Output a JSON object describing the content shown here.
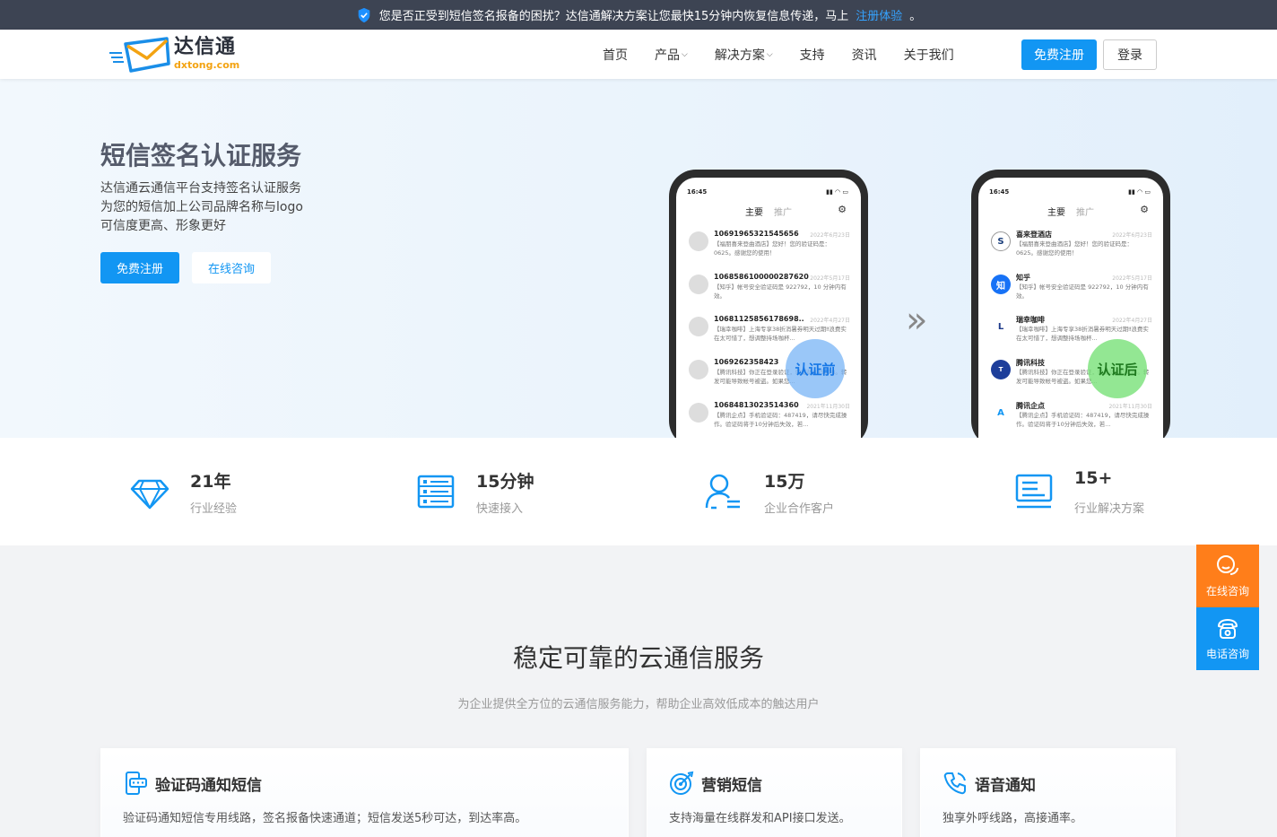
{
  "topbar": {
    "message": "您是否正受到短信签名报备的困扰？达信通解决方案让您最快15分钟内恢复信息传递，马上",
    "link": "注册体验",
    "end": "。"
  },
  "logo": {
    "cn": "达信通",
    "en": "dxtong.com"
  },
  "nav": {
    "items": [
      {
        "label": "首页"
      },
      {
        "label": "产品"
      },
      {
        "label": "解决方案"
      },
      {
        "label": "支持"
      },
      {
        "label": "资讯"
      },
      {
        "label": "关于我们"
      }
    ],
    "register": "免费注册",
    "login": "登录"
  },
  "hero": {
    "title": "短信签名认证服务",
    "desc": [
      "达信通云通信平台支持签名认证服务",
      "为您的短信加上公司品牌名称与logo",
      "可信度更高、形象更好"
    ],
    "btn_register": "免费注册",
    "btn_consult": "在线咨询"
  },
  "phones": {
    "time": "16:45",
    "tab_main": "主要",
    "tab_promo": "推广",
    "before_label": "认证前",
    "after_label": "认证后",
    "before": [
      {
        "name": "10691965321545656",
        "date": "2022年6月23日",
        "body": "【福朋喜来登曲酒店】您好！您的验证码是：0625。感谢您的使用！"
      },
      {
        "name": "1068586100000287620",
        "date": "2022年5月17日",
        "body": "【知乎】帐号安全验证码是 922792，10 分钟内有效。"
      },
      {
        "name": "10681125856178698..",
        "date": "2022年4月27日",
        "body": "【瑞幸咖啡】上海专享38折消暑券明天过期‼浪费实在太可惜了，想调整持场咖杯..."
      },
      {
        "name": "1069262358423",
        "date": "",
        "body": "【腾讯科技】你正在登录验证，验证码845898。转发可能导致帐号被盗。如果您..."
      },
      {
        "name": "10684813023514360",
        "date": "2021年11月30日",
        "body": "【腾讯企点】手机验证码：487419，请尽快完成操作。验证码将于10分钟后失效，若..."
      }
    ],
    "after": [
      {
        "name": "喜来登酒店",
        "date": "2022年6月23日",
        "body": "【福朋喜来登曲酒店】您好！您的验证码是：0625。感谢您的使用！",
        "avatar": "S"
      },
      {
        "name": "知乎",
        "date": "2022年5月17日",
        "body": "【知乎】帐号安全验证码是 922792，10 分钟内有效。",
        "avatar": "知"
      },
      {
        "name": "瑞幸咖啡",
        "date": "2022年4月27日",
        "body": "【瑞幸咖啡】上海专享38折消暑券明天过期‼浪费实在太可惜了，想调整持场咖杯...",
        "avatar": "L"
      },
      {
        "name": "腾讯科技",
        "date": "",
        "body": "【腾讯科技】你正在登录验证，验证码845898。转发可能导致帐号被盗。如果您...",
        "avatar": "T"
      },
      {
        "name": "腾讯企点",
        "date": "2021年11月30日",
        "body": "【腾讯企点】手机验证码：487419，请尽快完成操作。验证码将于10分钟后失效，若...",
        "avatar": "A"
      }
    ]
  },
  "stats": [
    {
      "num": "21年",
      "label": "行业经验",
      "icon": "diamond-icon"
    },
    {
      "num": "15分钟",
      "label": "快速接入",
      "icon": "server-icon"
    },
    {
      "num": "15万",
      "label": "企业合作客户",
      "icon": "user-list-icon"
    },
    {
      "num": "15+",
      "label": "行业解决方案",
      "icon": "document-icon"
    }
  ],
  "services": {
    "title": "稳定可靠的云通信服务",
    "subtitle": "为企业提供全方位的云通信服务能力，帮助企业高效低成本的触达用户",
    "cards": [
      {
        "title": "验证码通知短信",
        "desc": "验证码通知短信专用线路，签名报备快速通道；短信发送5秒可达，到达率高。"
      },
      {
        "title": "营销短信",
        "desc": "支持海量在线群发和API接口发送。"
      },
      {
        "title": "语音通知",
        "desc": "独享外呼线路，高接通率。"
      }
    ]
  },
  "float": {
    "consult": "在线咨询",
    "phone": "电话咨询"
  },
  "colors": {
    "primary": "#1296f3",
    "orange": "#ff7e1a",
    "topbar": "#3d4453"
  }
}
